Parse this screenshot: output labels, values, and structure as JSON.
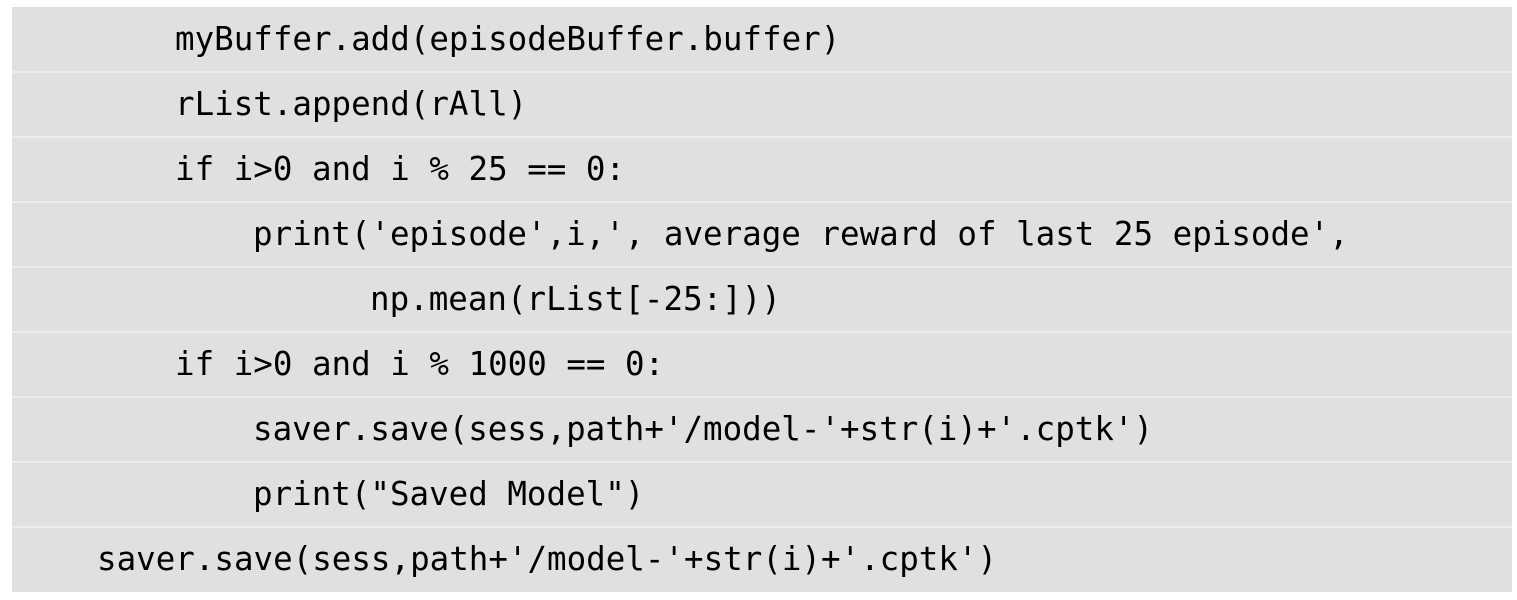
{
  "code": {
    "lines": [
      "myBuffer.add(episodeBuffer.buffer)",
      "rList.append(rAll)",
      "if i>0 and i % 25 == 0:",
      "print('episode',i,', average reward of last 25 episode',",
      "np.mean(rList[-25:]))",
      "if i>0 and i % 1000 == 0:",
      "saver.save(sess,path+'/model-'+str(i)+'.cptk')",
      "print(\"Saved Model\")",
      "saver.save(sess,path+'/model-'+str(i)+'.cptk')"
    ]
  },
  "colors": {
    "background": "#e0e0e0",
    "text": "#000000",
    "separator": "#ececec"
  }
}
